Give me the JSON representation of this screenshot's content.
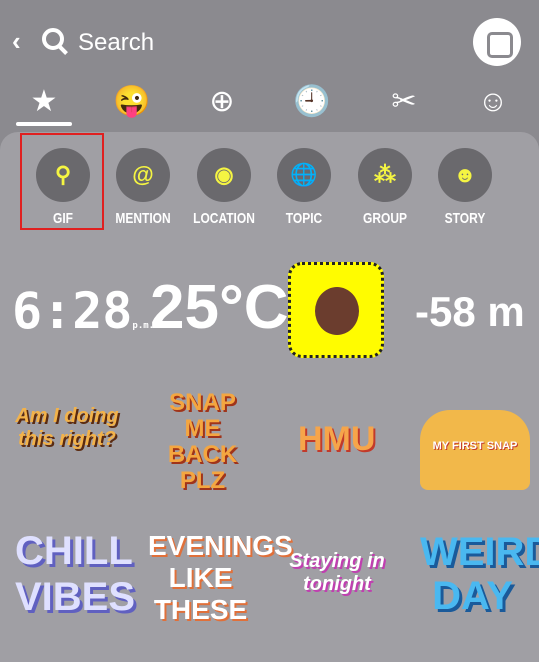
{
  "header": {
    "back": "‹",
    "search_placeholder": "Search"
  },
  "tabs": [
    {
      "icon": "star-icon",
      "glyph": "★"
    },
    {
      "icon": "bitmoji-icon",
      "glyph": "😜"
    },
    {
      "icon": "cameo-icon",
      "glyph": "⊕"
    },
    {
      "icon": "recent-clock-icon",
      "glyph": "🕘"
    },
    {
      "icon": "scissors-icon",
      "glyph": "✂"
    },
    {
      "icon": "emoji-icon",
      "glyph": "☺"
    }
  ],
  "categories": [
    {
      "label": "GIF",
      "glyph": "⚲"
    },
    {
      "label": "MENTION",
      "glyph": "@"
    },
    {
      "label": "LOCATION",
      "glyph": "◉"
    },
    {
      "label": "TOPIC",
      "glyph": "🌐"
    },
    {
      "label": "GROUP",
      "glyph": "⁂"
    },
    {
      "label": "STORY",
      "glyph": "☻"
    }
  ],
  "stickers": {
    "time": "6:28",
    "ampm": "p.m.",
    "temp": "25°C",
    "altitude": "-58 m",
    "s1": "Am I doing this right?",
    "s2": "SNAP ME BACK PLZ",
    "s3": "HMU",
    "s4": "MY FIRST SNAP",
    "s5": "CHILL VIBES",
    "s6": "EVENINGS LIKE THESE",
    "s7": "Staying in tonight",
    "s8": "WEIRD DAY"
  },
  "colors": {
    "accent": "#f5f542",
    "highlight": "#e02020"
  }
}
